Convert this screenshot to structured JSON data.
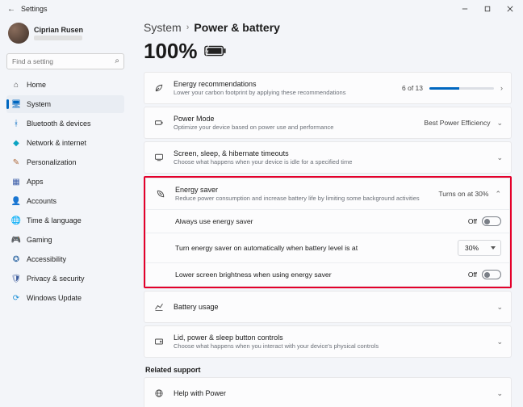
{
  "window": {
    "title": "Settings"
  },
  "profile": {
    "name": "Ciprian Rusen"
  },
  "search": {
    "placeholder": "Find a setting"
  },
  "nav": {
    "items": [
      {
        "label": "Home"
      },
      {
        "label": "System"
      },
      {
        "label": "Bluetooth & devices"
      },
      {
        "label": "Network & internet"
      },
      {
        "label": "Personalization"
      },
      {
        "label": "Apps"
      },
      {
        "label": "Accounts"
      },
      {
        "label": "Time & language"
      },
      {
        "label": "Gaming"
      },
      {
        "label": "Accessibility"
      },
      {
        "label": "Privacy & security"
      },
      {
        "label": "Windows Update"
      }
    ]
  },
  "breadcrumb": {
    "parent": "System",
    "current": "Power & battery"
  },
  "battery": {
    "percent": "100%"
  },
  "cards": {
    "energy_rec": {
      "title": "Energy recommendations",
      "sub": "Lower your carbon footprint by applying these recommendations",
      "badge": "6 of 13"
    },
    "power_mode": {
      "title": "Power Mode",
      "sub": "Optimize your device based on power use and performance",
      "value": "Best Power Efficiency"
    },
    "screen_sleep": {
      "title": "Screen, sleep, & hibernate timeouts",
      "sub": "Choose what happens when your device is idle for a specified time"
    },
    "energy_saver": {
      "title": "Energy saver",
      "sub": "Reduce power consumption and increase battery life by limiting some background activities",
      "status": "Turns on at 30%",
      "row1": {
        "label": "Always use energy saver",
        "toggle": "Off"
      },
      "row2": {
        "label": "Turn energy saver on automatically when battery level is at",
        "value": "30%"
      },
      "row3": {
        "label": "Lower screen brightness when using energy saver",
        "toggle": "Off"
      }
    },
    "battery_usage": {
      "title": "Battery usage"
    },
    "lid": {
      "title": "Lid, power & sleep button controls",
      "sub": "Choose what happens when you interact with your device's physical controls"
    }
  },
  "related": {
    "heading": "Related support",
    "help": "Help with Power"
  }
}
